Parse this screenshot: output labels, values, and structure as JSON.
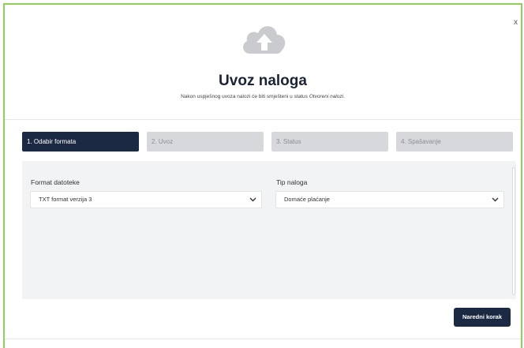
{
  "modal": {
    "close_label": "x",
    "icon": "cloud-upload-icon",
    "title": "Uvoz naloga",
    "subtitle_prefix": "Nakon uspješnog uvoza nalozi će biti smješteni u status ",
    "subtitle_status": "Otvoreni nalozi",
    "subtitle_suffix": "."
  },
  "steps": [
    {
      "label": "1. Odabir formata",
      "active": true
    },
    {
      "label": "2. Uvoz",
      "active": false
    },
    {
      "label": "3. Status",
      "active": false
    },
    {
      "label": "4. Spašavanje",
      "active": false
    }
  ],
  "form": {
    "format_label": "Format datoteke",
    "format_value": "TXT format verzija 3",
    "type_label": "Tip naloga",
    "type_value": "Domaće plaćanje"
  },
  "actions": {
    "next_label": "Naredni korak"
  },
  "colors": {
    "accent_dark": "#1b2a42",
    "border_green": "#8fcf5b",
    "step_inactive": "#d6d8db",
    "panel_bg": "#f2f3f5"
  }
}
